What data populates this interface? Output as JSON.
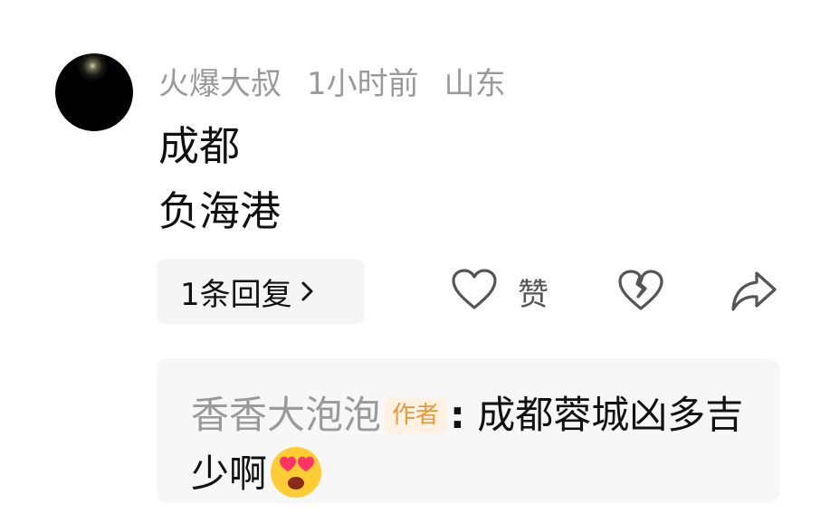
{
  "comment": {
    "username": "火爆大叔",
    "time": "1小时前",
    "location": "山东",
    "lines": [
      "成都",
      "负海港"
    ],
    "reply_count_label": "1条回复",
    "like_label": "赞"
  },
  "reply": {
    "username": "香香大泡泡",
    "author_tag": "作者",
    "separator": ":",
    "text": "成都蓉城凶多吉少啊",
    "emoji": "heart-eyes-emoji"
  },
  "colors": {
    "meta_gray": "#9a9a9a",
    "author_tag": "#e89a3a",
    "author_tag_bg": "#fdf1e1",
    "card_bg": "#f7f7f7"
  }
}
